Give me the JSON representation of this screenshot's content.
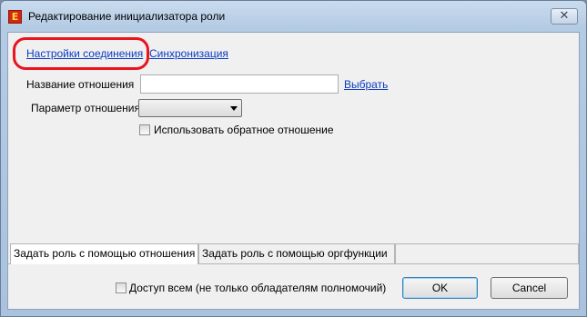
{
  "window": {
    "title": "Редактирование инициализатора роли",
    "app_icon_glyph": "E",
    "close_glyph": "✕"
  },
  "top_tabs": {
    "connection_settings": "Настройки соединения",
    "sync": "Синхронизация"
  },
  "form": {
    "relation_name_label": "Название отношения",
    "relation_name_value": "",
    "choose_link": "Выбрать",
    "relation_param_label": "Параметр отношения",
    "relation_param_value": "",
    "use_reverse_label": "Использовать обратное отношение",
    "use_reverse_checked": false
  },
  "bottom_tabs": {
    "by_relation": "Задать роль с помощью отношения",
    "by_orgfunction": "Задать роль с помощью оргфункции",
    "active": "by_relation"
  },
  "footer": {
    "access_all_label": "Доступ всем (не только обладателям полномочий)",
    "access_all_checked": false,
    "ok_label": "OK",
    "cancel_label": "Cancel"
  },
  "colors": {
    "link": "#0b3cc2",
    "highlight_ring": "#e8141e",
    "titlebar": "#b4cbe4"
  }
}
